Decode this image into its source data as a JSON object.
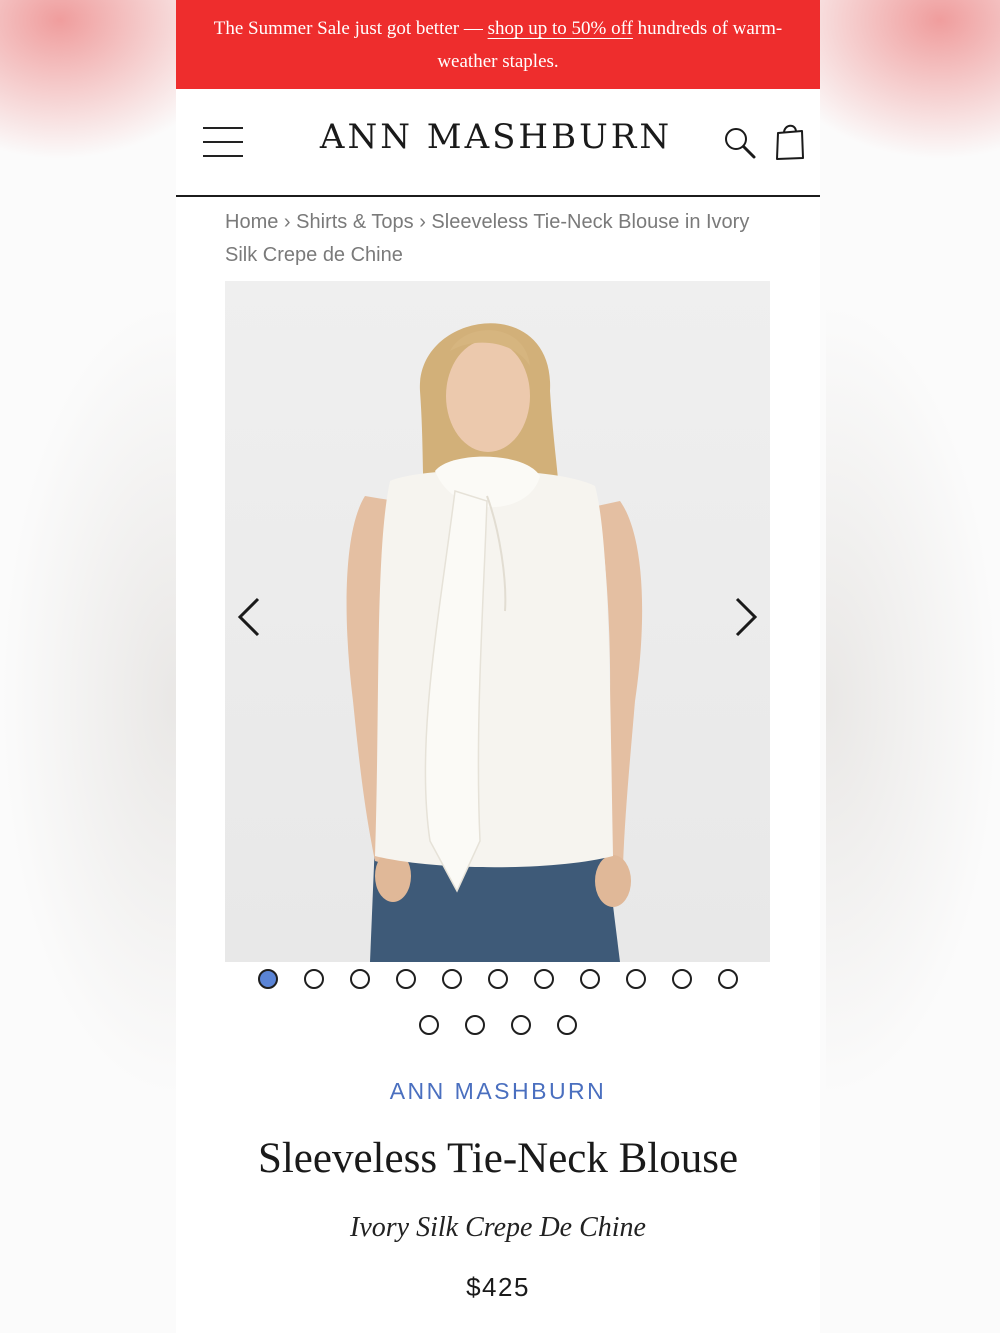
{
  "promo": {
    "text_before": "The Summer Sale just got better — ",
    "link_text": "shop up to 50% off",
    "text_after": " hundreds of warm-weather staples."
  },
  "header": {
    "logo": "ANN MASHBURN",
    "menu_icon": "hamburger-menu-icon",
    "search_icon": "search-icon",
    "bag_icon": "shopping-bag-icon"
  },
  "breadcrumb": {
    "items": [
      "Home",
      "Shirts & Tops",
      "Sleeveless Tie-Neck Blouse in Ivory Silk Crepe de Chine"
    ],
    "separator": "›"
  },
  "gallery": {
    "image_count": 15,
    "active_index": 0,
    "prev_icon": "chevron-left-icon",
    "next_icon": "chevron-right-icon"
  },
  "product": {
    "brand": "ANN MASHBURN",
    "title": "Sleeveless Tie-Neck Blouse",
    "subtitle": "Ivory Silk Crepe De Chine",
    "price": "$425"
  },
  "colors": {
    "promo_bg": "#ee2d2d",
    "brand_blue": "#4a6fbf",
    "active_dot": "#5a84d6"
  }
}
